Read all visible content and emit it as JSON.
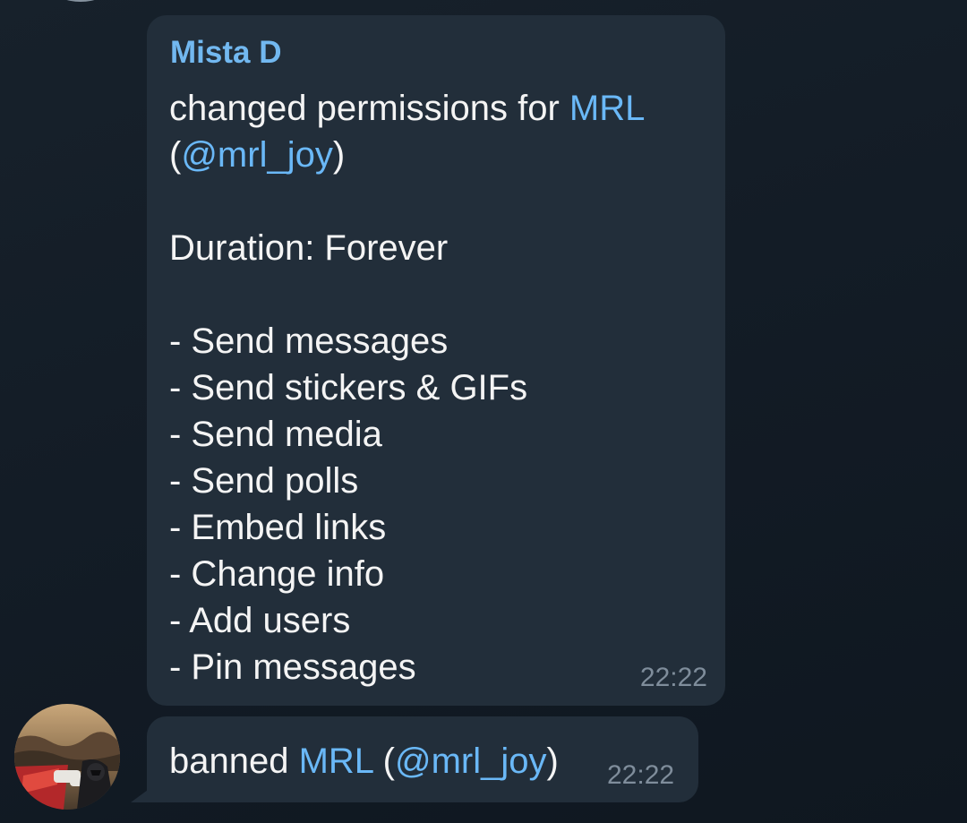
{
  "messages": [
    {
      "sender": "Mista D",
      "lines": [
        {
          "parts": [
            "changed permissions for ",
            "MRL"
          ]
        },
        {
          "parts": [
            "(",
            "@mrl_joy",
            ")"
          ]
        },
        {
          "gap": true
        },
        {
          "text": "Duration: Forever"
        },
        {
          "gap": true
        },
        {
          "text": "- Send messages"
        },
        {
          "text": "- Send stickers & GIFs"
        },
        {
          "text": "- Send media"
        },
        {
          "text": "- Send polls"
        },
        {
          "text": "- Embed links"
        },
        {
          "text": "- Change info"
        },
        {
          "text": "- Add users"
        },
        {
          "text": "- Pin messages"
        }
      ],
      "time": "22:22"
    },
    {
      "text_prefix": "banned ",
      "user_name": "MRL",
      "user_handle_open": " (",
      "user_handle": "@mrl_joy",
      "user_handle_close": ")",
      "time": "22:22"
    }
  ],
  "first_message": {
    "line1_prefix": "changed permissions for ",
    "line1_link": "MRL",
    "line2_open": "(",
    "line2_link": "@mrl_joy",
    "line2_close": ")",
    "duration": "Duration: Forever",
    "permissions": [
      "- Send messages",
      "- Send stickers & GIFs",
      "- Send media",
      "- Send polls",
      "- Embed links",
      "- Change info",
      "- Add users",
      "- Pin messages"
    ]
  },
  "colors": {
    "background": "#17212b",
    "bubble": "#222e3a",
    "sender_name": "#72b8f0",
    "link": "#6ab8f7",
    "timestamp": "#7f8d9b"
  },
  "icons": {
    "avatar": "user-avatar-icon"
  }
}
